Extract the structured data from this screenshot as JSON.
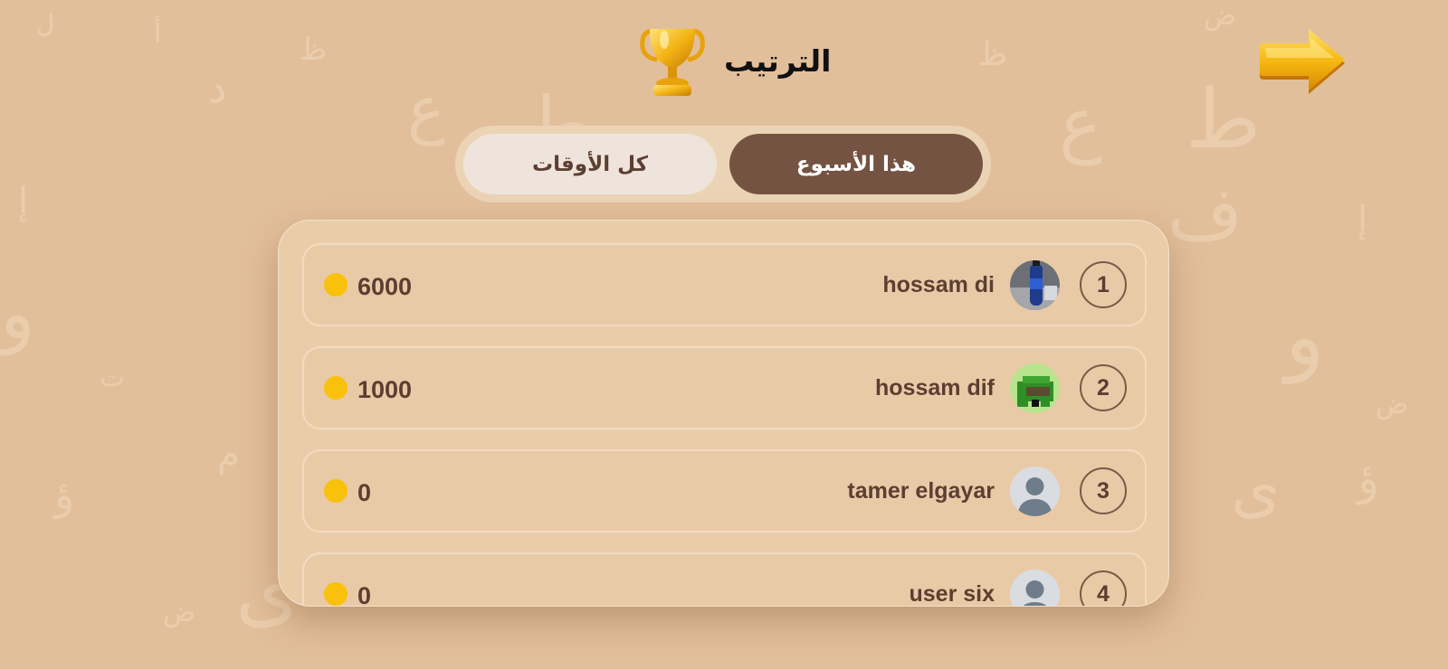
{
  "header": {
    "title": "الترتيب"
  },
  "tabs": [
    {
      "label": "هذا الأسبوع",
      "active": true
    },
    {
      "label": "كل الأوقات",
      "active": false
    }
  ],
  "leaderboard": [
    {
      "rank": "1",
      "name": "hossam di",
      "score": "6000",
      "avatar": "photo"
    },
    {
      "rank": "2",
      "name": "hossam dif",
      "score": "1000",
      "avatar": "pixel-art"
    },
    {
      "rank": "3",
      "name": "tamer elgayar",
      "score": "0",
      "avatar": "default-user"
    },
    {
      "rank": "4",
      "name": "user six",
      "score": "0",
      "avatar": "default-user"
    }
  ],
  "icons": {
    "trophy": "trophy-icon",
    "back": "arrow-right-icon",
    "coin": "coin-icon"
  },
  "colors": {
    "background": "#e2bf9b",
    "active_tab": "#755342",
    "inactive_tab": "#efe4db",
    "coin": "#f9c10b",
    "text_dark": "#5c3e32"
  }
}
